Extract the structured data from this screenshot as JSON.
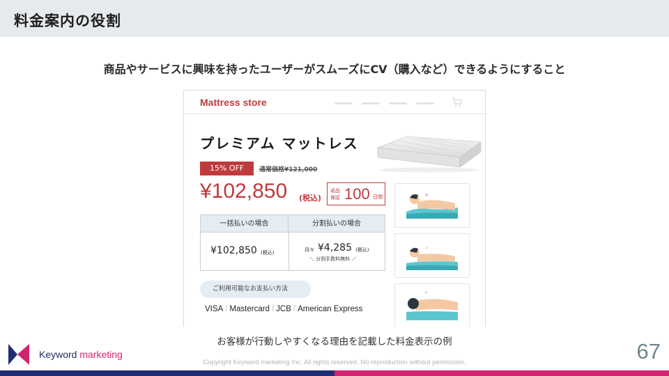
{
  "slide": {
    "title": "料金案内の役割",
    "subtitle": "商品やサービスに興味を持ったユーザーがスムーズにCV（購入など）できるようにすること",
    "caption": "お客様が行動しやすくなる理由を記載した料金表示の例",
    "page_number": "67",
    "copyright": "Copyright Keyword marketing Inc. All rights reserved. No reproduction without permission."
  },
  "brand": {
    "name_part1": "Keyword",
    "name_part2": "marketing",
    "colors": {
      "navy": "#1f2e72",
      "magenta": "#d1246e"
    }
  },
  "mockup": {
    "store_name": "Mattress store",
    "product_name": "プレミアム マットレス",
    "discount_badge": "15% OFF",
    "regular_price": "通常価格¥121,000",
    "price": "¥102,850",
    "tax_label": "(税込)",
    "guarantee": {
      "label": "返品保証",
      "number": "100",
      "unit": "日間"
    },
    "payment_table": {
      "header_lump": "一括払いの場合",
      "header_installment": "分割払いの場合",
      "lump_price": "¥102,850",
      "lump_tax": "(税込)",
      "monthly_prefix": "月々",
      "monthly_price": "¥4,285",
      "monthly_tax": "(税込)",
      "fee_note": "＼ 分割手数料無料 ／"
    },
    "payment_methods_label": "ご利用可能なお支払い方法",
    "payment_methods": [
      "VISA",
      "Mastercard",
      "JCB",
      "American Express"
    ],
    "accent_color": "#c0393b"
  }
}
